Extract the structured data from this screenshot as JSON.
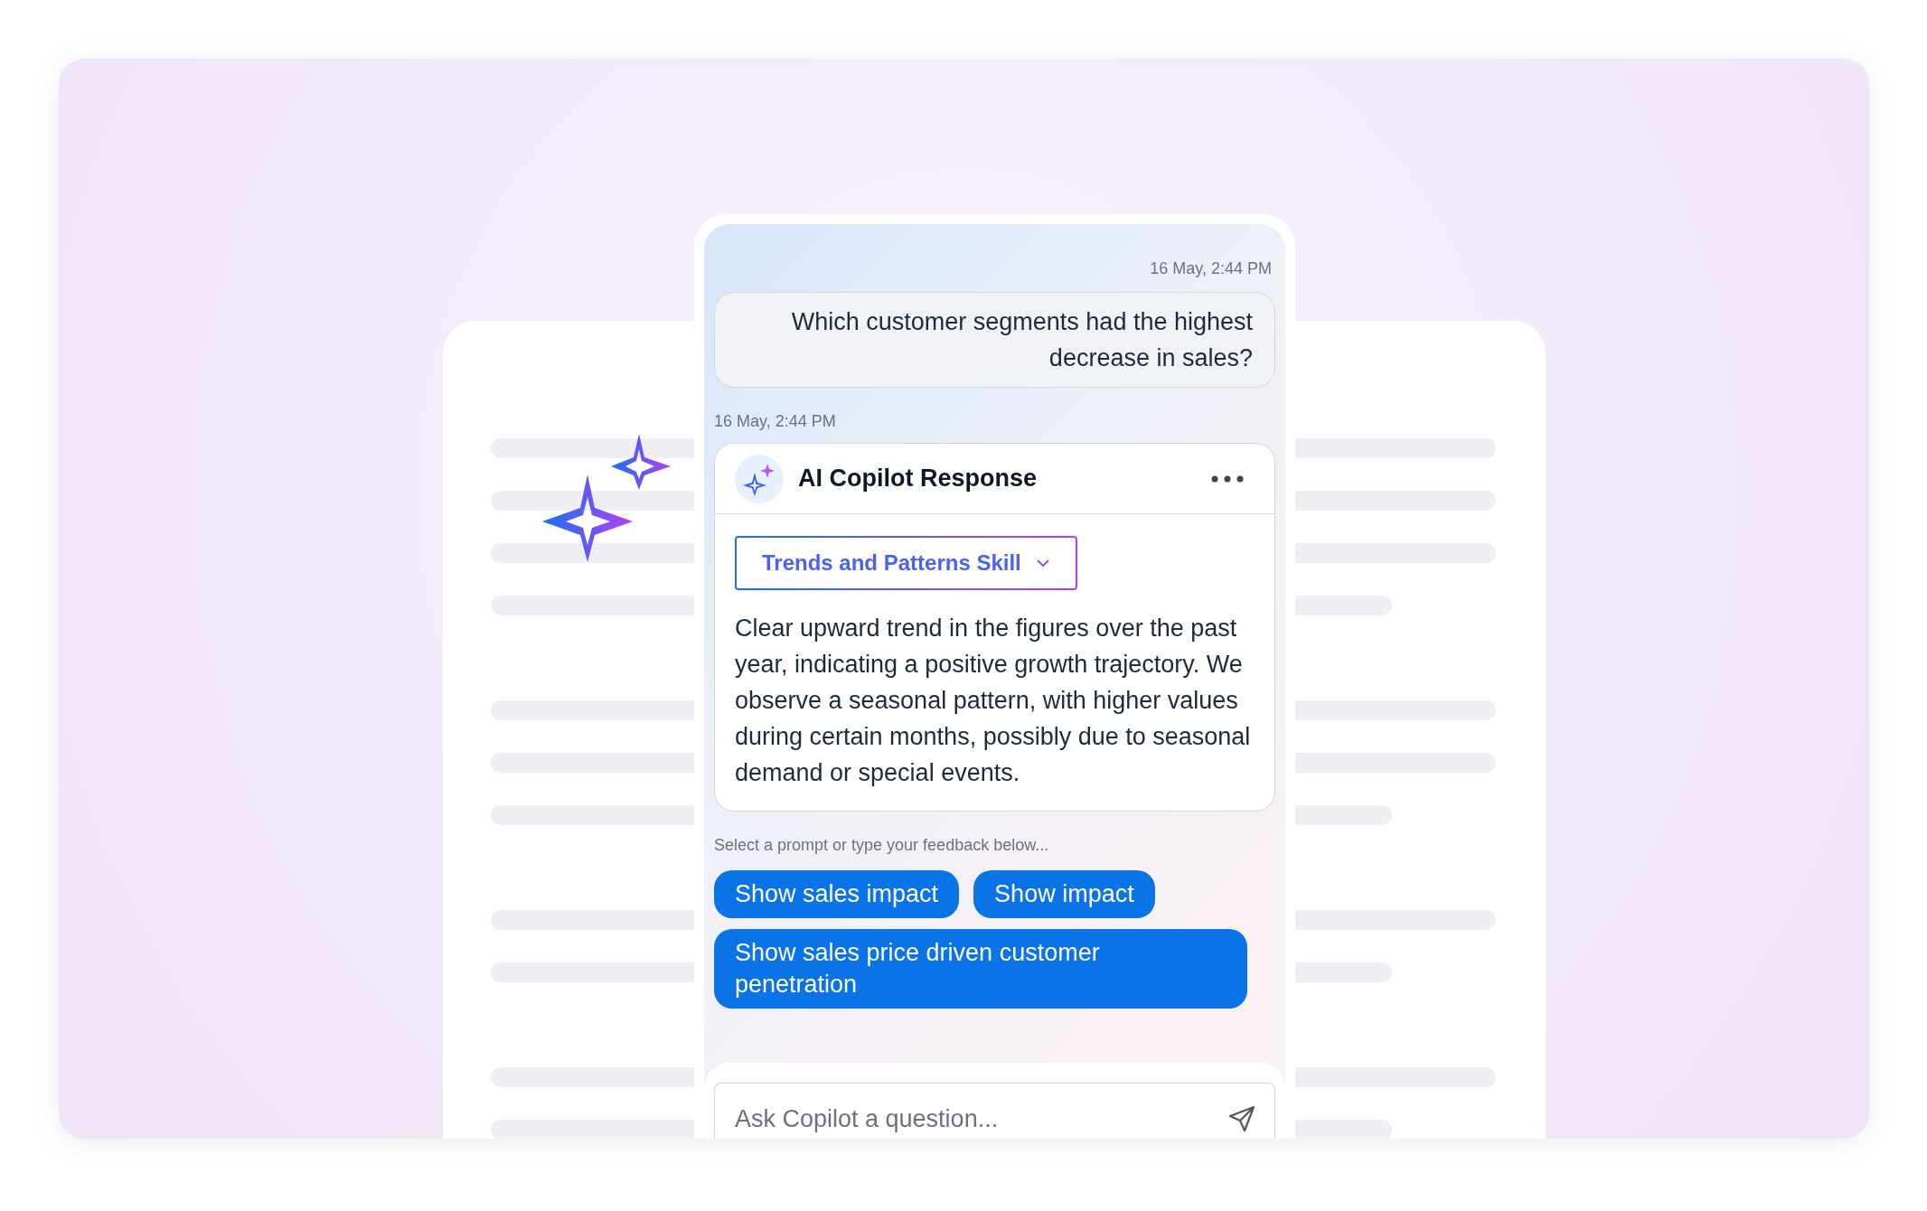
{
  "user_message": {
    "timestamp": "16 May, 2:44 PM",
    "text": "Which customer segments had the highest decrease in sales?"
  },
  "response": {
    "timestamp": "16 May, 2:44 PM",
    "title": "AI Copilot Response",
    "skill": {
      "label": "Trends and Patterns Skill"
    },
    "text": "Clear upward trend in the figures over the past year, indicating a positive growth trajectory. We observe a seasonal pattern, with higher values during certain months, possibly due to seasonal demand or special events."
  },
  "feedback_hint": "Select a prompt or type your feedback below...",
  "prompts": [
    "Show sales impact",
    "Show impact",
    "Show sales price driven customer penetration"
  ],
  "input": {
    "placeholder": "Ask Copilot a question..."
  }
}
